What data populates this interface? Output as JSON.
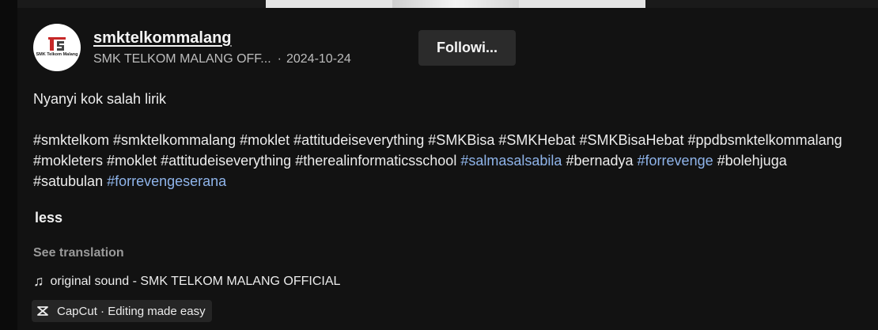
{
  "author": {
    "username": "smktelkommalang",
    "display_name": "SMK TELKOM MALANG OFF...",
    "date": "2024-10-24",
    "avatar_text": "SMK Telkom Malang"
  },
  "follow_button": {
    "label": "Followi..."
  },
  "description": {
    "caption": "Nyanyi kok salah lirik",
    "hashtags": [
      {
        "text": "#smktelkom",
        "highlight": false
      },
      {
        "text": "#smktelkommalang",
        "highlight": false
      },
      {
        "text": "#moklet",
        "highlight": false
      },
      {
        "text": "#attitudeiseverything",
        "highlight": false
      },
      {
        "text": "#SMKBisa",
        "highlight": false
      },
      {
        "text": "#SMKHebat",
        "highlight": false
      },
      {
        "text": "#SMKBisaHebat",
        "highlight": false
      },
      {
        "text": "#ppdbsmktelkommalang",
        "highlight": false
      },
      {
        "text": "#mokleters",
        "highlight": false
      },
      {
        "text": "#moklet",
        "highlight": false
      },
      {
        "text": "#attitudeiseverything",
        "highlight": false
      },
      {
        "text": "#therealinformaticsschool",
        "highlight": false
      },
      {
        "text": "#salmasalsabila",
        "highlight": true
      },
      {
        "text": "#bernadya",
        "highlight": false
      },
      {
        "text": "#forrevenge",
        "highlight": true
      },
      {
        "text": "#bolehjuga",
        "highlight": false
      },
      {
        "text": "#satubulan",
        "highlight": false
      },
      {
        "text": "#forrevengeserana",
        "highlight": true
      }
    ]
  },
  "less_label": "less",
  "see_translation_label": "See translation",
  "sound": {
    "icon": "music-note-icon",
    "label": "original sound - SMK TELKOM MALANG OFFICIAL"
  },
  "capcut": {
    "icon": "capcut-icon",
    "label": "CapCut · Editing made easy"
  },
  "colors": {
    "background": "#121212",
    "hashtag_highlight": "#8fb4ea",
    "button_bg": "#2b2b2b"
  }
}
